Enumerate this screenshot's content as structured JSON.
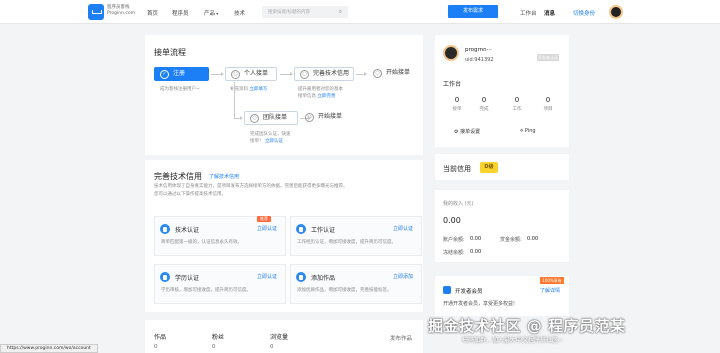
{
  "nav": {
    "logo_text_line1": "程序员客栈",
    "logo_text_line2": "Proginn.com",
    "items": [
      "首页",
      "程序员",
      "产品",
      "技术"
    ],
    "search_placeholder": "搜索技能/标题的内容",
    "post_button": "发布需求",
    "right": [
      "工作台",
      "消息",
      "切换身份"
    ]
  },
  "process": {
    "title": "接单流程",
    "steps": [
      {
        "num": "✓",
        "label": "注册",
        "desc": "成为客栈注册用户~"
      },
      {
        "num": "○",
        "label": "个人接单",
        "desc": "补充资料",
        "link": "立即填写"
      },
      {
        "num": "○",
        "label": "完善技术信用",
        "desc": "提升雇用者对您的基本",
        "desc2": "接单信息",
        "link": "立即完善"
      },
      {
        "num": "○",
        "label": "开始接单",
        "desc": ""
      },
      {
        "num": "○",
        "label": "团队接单",
        "desc": "完成团队认证，快速",
        "desc2": "接单！",
        "link": "立即认证"
      },
      {
        "num": "○",
        "label": "开始接单",
        "desc": ""
      }
    ]
  },
  "credit": {
    "title": "完善技术信用",
    "link": "了解技术信用",
    "intro1": "技术信用体现了自身真实能力，是项目发布方选择接单方的依据。完善后能获得更多曝光与推荐。",
    "intro2": "您可以通过以下操作提高技术信用。",
    "items": [
      {
        "name": "技术认证",
        "link": "立即认证",
        "desc": "简单匹配第一级的，认证信息永久有效。",
        "tag": "推荐"
      },
      {
        "name": "工作认证",
        "link": "立即认证",
        "desc": "工作经历认证，增加可接收度，提升简历可信度。"
      },
      {
        "name": "学历认证",
        "link": "立即认证",
        "desc": "学历审核，增加可接收度，提升简历可信度。"
      },
      {
        "name": "添加作品",
        "link": "立即添加",
        "desc": "添加优质作品，增加可接收度，完善技能标签。"
      }
    ]
  },
  "bottom": {
    "cols": [
      {
        "h": "作品",
        "v": "0"
      },
      {
        "h": "粉丝",
        "v": "0"
      },
      {
        "h": "浏览量",
        "v": "0"
      }
    ],
    "publish": "发布作品"
  },
  "profile": {
    "name": "progrnn···",
    "uid": "uid:941392",
    "badge": "开发者认证",
    "workbench_title": "工作台",
    "stats": [
      {
        "v": "0",
        "l": "接单"
      },
      {
        "v": "0",
        "l": "完成"
      },
      {
        "v": "0",
        "l": "工作"
      },
      {
        "v": "0",
        "l": "项目"
      }
    ],
    "tools": [
      "接单设置",
      "Ping"
    ]
  },
  "credit_panel": {
    "title": "当前信用",
    "badge": "D级"
  },
  "wallet": {
    "label": "我的收入 (元)",
    "total": "0.00",
    "rows": [
      {
        "l": "账户余额:",
        "v": "0.00"
      },
      {
        "l": "赏金余额:",
        "v": "0.00"
      },
      {
        "l": "冻结余额:",
        "v": "0.00"
      }
    ]
  },
  "member": {
    "title": "开发者会员",
    "badge": "100%享有",
    "link": "了解详情",
    "desc": "开通开发者会员，享受更多权益!"
  },
  "url": "https://www.proginn.com/wo/account",
  "watermark": "掘金技术社区 @ 程序员范某",
  "watermark_sub": "扫码加群，加入最大中文程序员社区~"
}
